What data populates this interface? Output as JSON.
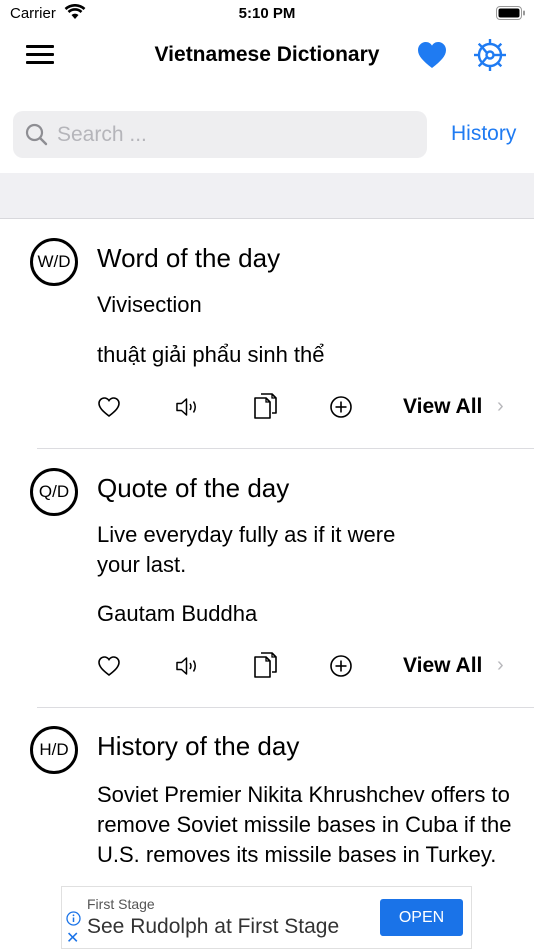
{
  "status_bar": {
    "carrier": "Carrier",
    "time": "5:10 PM"
  },
  "nav": {
    "title": "Vietnamese Dictionary",
    "menu_icon": "hamburger-menu-icon",
    "favorite_icon": "heart-icon",
    "settings_icon": "gear-icon"
  },
  "search": {
    "placeholder": "Search ...",
    "value": "",
    "history_label": "History"
  },
  "colors": {
    "accent": "#1f7bf2",
    "band": "#f0f0f3"
  },
  "cards": [
    {
      "badge": "W/D",
      "title": "Word of the day",
      "lines": [
        "Vivisection",
        "thuật giải phẩu sinh thể"
      ],
      "view_all": "View All"
    },
    {
      "badge": "Q/D",
      "title": "Quote of the day",
      "lines": [
        "Live everyday fully as if it were your last.",
        "Gautam Buddha"
      ],
      "view_all": "View All"
    },
    {
      "badge": "H/D",
      "title": "History of the day",
      "lines": [
        "Soviet Premier Nikita Khrushchev offers to remove Soviet missile bases in Cuba if the U.S. removes its missile bases in Turkey."
      ]
    }
  ],
  "ad": {
    "advertiser": "First Stage",
    "headline": "See Rudolph at First Stage",
    "cta": "OPEN"
  }
}
